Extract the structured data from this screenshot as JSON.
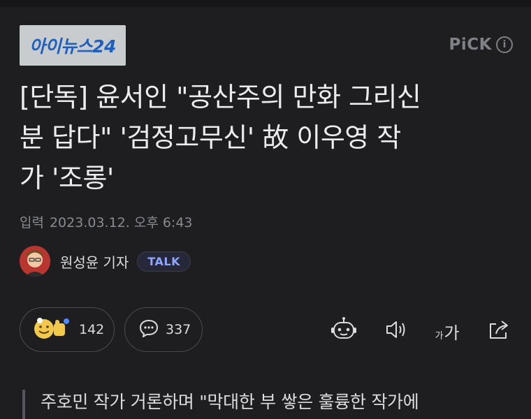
{
  "publisher": {
    "logo_text": "아이뉴스24"
  },
  "badge": {
    "pick_label": "PiCK",
    "info_glyph": "i"
  },
  "article": {
    "headline_lines": [
      "[단독] 윤서인 \"공산주의 만화 그리신",
      "분 답다\" '검정고무신' 故 이우영 작",
      "가 '조롱'"
    ],
    "date_label": "입력",
    "date_value": "2023.03.12. 오후 6:43",
    "reporter_name": "원성윤 기자",
    "talk_label": "TALK"
  },
  "reactions": {
    "count": "142",
    "icon": "emoji-reaction-icon"
  },
  "comments": {
    "count": "337",
    "icon": "comment-icon"
  },
  "toolbar": {
    "icons": [
      "robot-summary-icon",
      "speaker-icon",
      "font-size-icon",
      "share-icon"
    ],
    "font_small": "가",
    "font_big": "가"
  },
  "body": {
    "quote_text": "주호민 작가 거론하며 \"막대한 부 쌓은 훌륭한 작가에"
  },
  "colors": {
    "background": "#1e1e20",
    "accent_talk": "#8fa6ff",
    "logo_blue": "#1f5fbf"
  }
}
